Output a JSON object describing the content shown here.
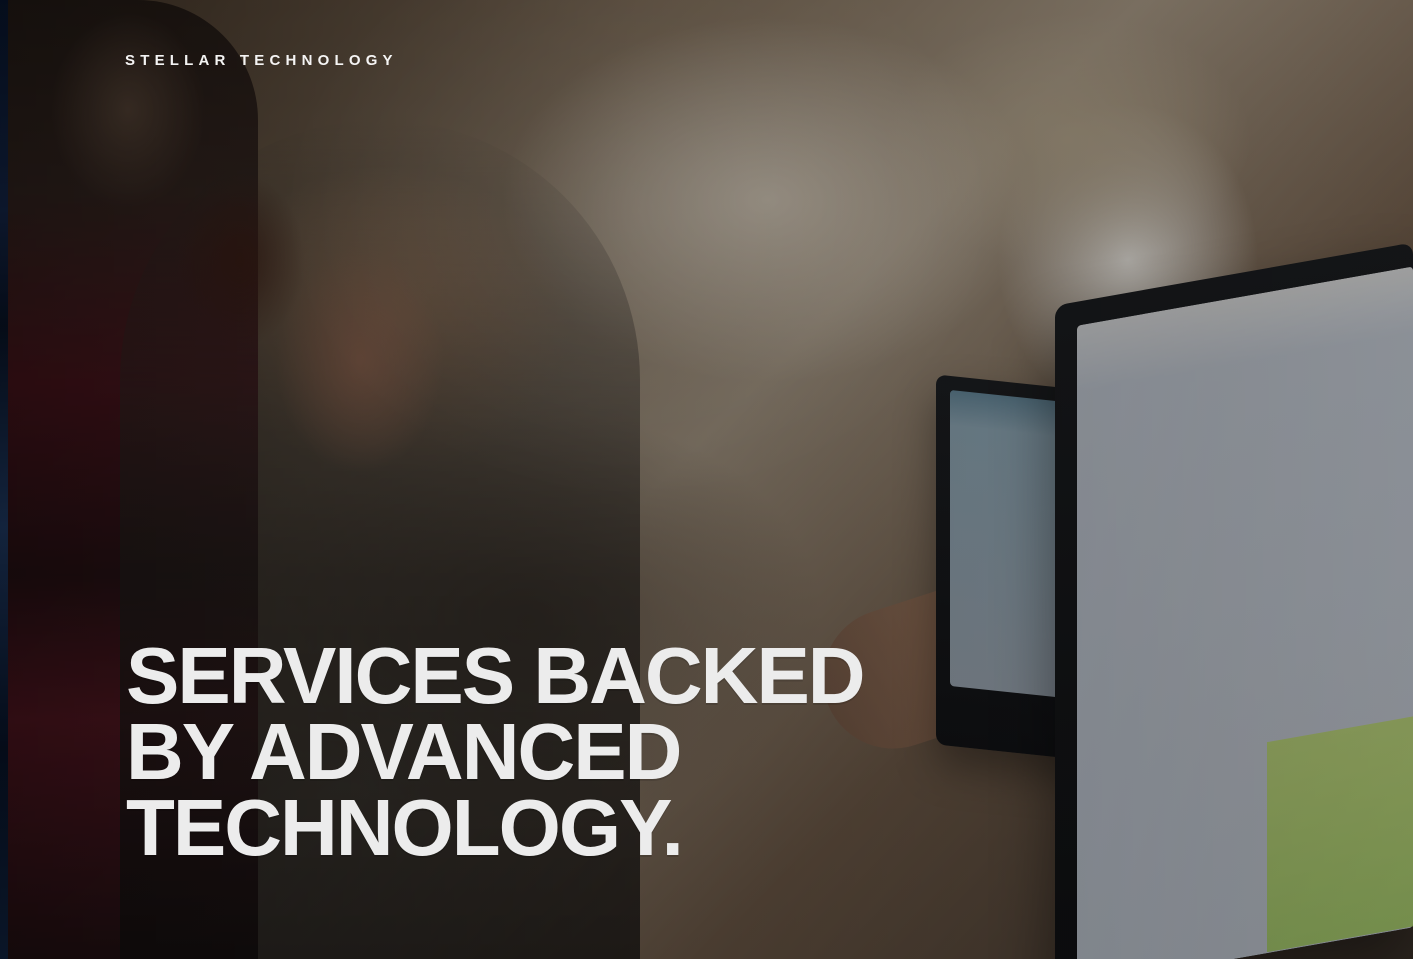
{
  "hero": {
    "brand_label": "STELLAR TECHNOLOGY",
    "headline_lines": [
      "SERVICES BACKED",
      "BY ADVANCED",
      "TECHNOLOGY."
    ]
  }
}
